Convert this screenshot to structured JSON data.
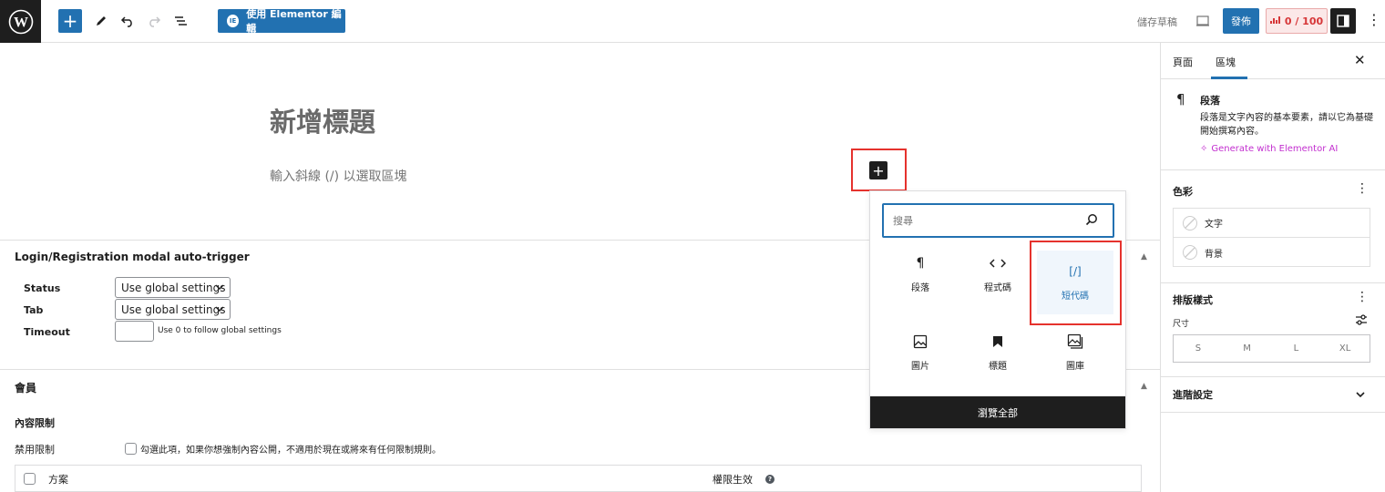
{
  "toolbar": {
    "elementor_label": "使用 Elementor 編輯",
    "elementor_icon_text": "IE",
    "save_draft": "儲存草稿",
    "publish": "發佈",
    "score": "0 / 100"
  },
  "editor": {
    "title_placeholder": "新增標題",
    "paragraph_placeholder": "輸入斜線 (/) 以選取區塊"
  },
  "inserter": {
    "search_placeholder": "搜尋",
    "blocks": [
      {
        "label": "段落",
        "icon": "paragraph-icon"
      },
      {
        "label": "程式碼",
        "icon": "code-icon"
      },
      {
        "label": "短代碼",
        "icon": "shortcode-icon",
        "glyph": "[/]"
      },
      {
        "label": "圖片",
        "icon": "image-icon"
      },
      {
        "label": "標題",
        "icon": "bookmark-icon"
      },
      {
        "label": "圖庫",
        "icon": "gallery-icon"
      }
    ],
    "browse_all": "瀏覽全部"
  },
  "metabox_login": {
    "title": "Login/Registration modal auto-trigger",
    "status_label": "Status",
    "status_value": "Use global settings",
    "tab_label": "Tab",
    "tab_value": "Use global settings",
    "timeout_label": "Timeout",
    "timeout_help": "Use 0 to follow global settings"
  },
  "metabox_member": {
    "title": "會員",
    "content_restriction": "內容限制",
    "disable_label": "禁用限制",
    "disable_help": "勾選此項，如果你想強制內容公開，不適用於現在或將來有任何限制規則。",
    "col_plan": "方案",
    "col_effective": "權限生效",
    "help_glyph": "?"
  },
  "sidebar": {
    "tab_page": "頁面",
    "tab_block": "區塊",
    "block_title": "段落",
    "block_desc": "段落是文字內容的基本要素，請以它為基礎開始撰寫內容。",
    "ai_link": "Generate with Elementor AI",
    "color_heading": "色彩",
    "color_text": "文字",
    "color_bg": "背景",
    "typography_heading": "排版樣式",
    "size_label": "尺寸",
    "sizes": [
      "S",
      "M",
      "L",
      "XL"
    ],
    "advanced_heading": "進階設定"
  },
  "colors": {
    "accent": "#2271b1",
    "highlight": "#e5322d",
    "ai": "#c22ecf"
  }
}
